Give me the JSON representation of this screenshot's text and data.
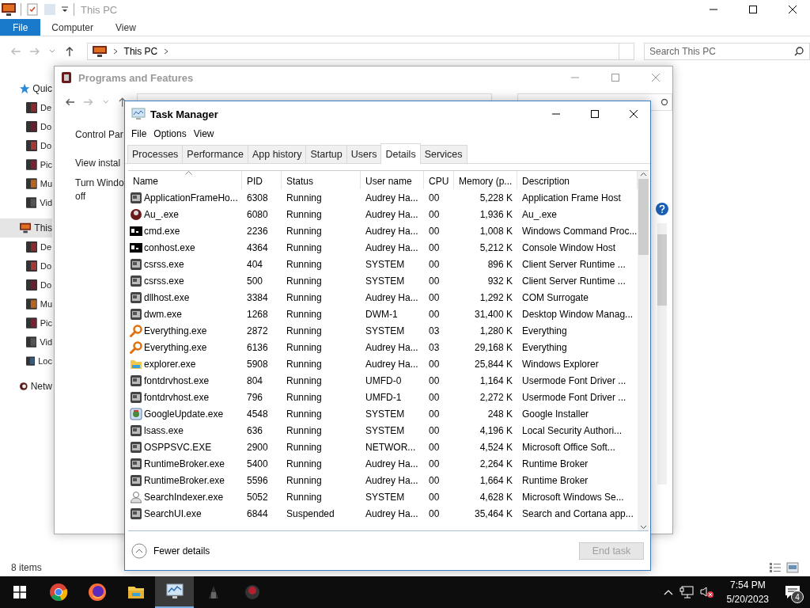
{
  "explorer": {
    "title": "This PC",
    "ribbon_tabs": [
      {
        "label": "File",
        "selected": true
      },
      {
        "label": "Computer",
        "selected": false
      },
      {
        "label": "View",
        "selected": false
      }
    ],
    "address": [
      "This PC"
    ],
    "search": {
      "placeholder": "Search This PC"
    },
    "nav": [
      {
        "label": "Quic",
        "kind": "star",
        "selected": false,
        "children": [
          {
            "label": "De",
            "kind": "desktop",
            "selected": false
          },
          {
            "label": "Do",
            "kind": "downloads",
            "selected": false
          },
          {
            "label": "Do",
            "kind": "documents",
            "selected": false
          },
          {
            "label": "Pic",
            "kind": "pictures",
            "selected": false
          },
          {
            "label": "Mu",
            "kind": "music",
            "selected": false
          },
          {
            "label": "Vid",
            "kind": "videos",
            "selected": false
          }
        ]
      },
      {
        "label": "This",
        "kind": "pc",
        "selected": true,
        "children": [
          {
            "label": "De",
            "kind": "desktop",
            "selected": false
          },
          {
            "label": "Do",
            "kind": "documents",
            "selected": false
          },
          {
            "label": "Do",
            "kind": "downloads",
            "selected": false
          },
          {
            "label": "Mu",
            "kind": "music",
            "selected": false
          },
          {
            "label": "Pic",
            "kind": "pictures",
            "selected": false
          },
          {
            "label": "Vid",
            "kind": "videos",
            "selected": false
          },
          {
            "label": "Loc",
            "kind": "drive",
            "selected": false
          }
        ]
      },
      {
        "label": "Netw",
        "kind": "network",
        "selected": false
      }
    ],
    "status": "8 items"
  },
  "programs_window": {
    "title": "Programs and Features",
    "links": [
      "Control Par",
      "View instal",
      "Turn Windo off"
    ]
  },
  "task_manager": {
    "title": "Task Manager",
    "menu": [
      "File",
      "Options",
      "View"
    ],
    "tabs": [
      {
        "label": "Processes",
        "selected": false
      },
      {
        "label": "Performance",
        "selected": false
      },
      {
        "label": "App history",
        "selected": false
      },
      {
        "label": "Startup",
        "selected": false
      },
      {
        "label": "Users",
        "selected": false
      },
      {
        "label": "Details",
        "selected": true
      },
      {
        "label": "Services",
        "selected": false
      }
    ],
    "columns": [
      {
        "label": "Name",
        "sorted": true
      },
      {
        "label": "PID",
        "sorted": false
      },
      {
        "label": "Status",
        "sorted": false
      },
      {
        "label": "User name",
        "sorted": false
      },
      {
        "label": "CPU",
        "sorted": false
      },
      {
        "label": "Memory (p...",
        "sorted": false
      },
      {
        "label": "Description",
        "sorted": false
      }
    ],
    "rows": [
      {
        "kind": "app",
        "name": "ApplicationFrameHo...",
        "pid": "6308",
        "status": "Running",
        "user": "Audrey Ha...",
        "cpu": "00",
        "memory": "5,228 K",
        "description": "Application Frame Host"
      },
      {
        "kind": "round",
        "name": "Au_.exe",
        "pid": "6080",
        "status": "Running",
        "user": "Audrey Ha...",
        "cpu": "00",
        "memory": "1,936 K",
        "description": "Au_.exe"
      },
      {
        "kind": "console",
        "name": "cmd.exe",
        "pid": "2236",
        "status": "Running",
        "user": "Audrey Ha...",
        "cpu": "00",
        "memory": "1,008 K",
        "description": "Windows Command Proc..."
      },
      {
        "kind": "console",
        "name": "conhost.exe",
        "pid": "4364",
        "status": "Running",
        "user": "Audrey Ha...",
        "cpu": "00",
        "memory": "5,212 K",
        "description": "Console Window Host"
      },
      {
        "kind": "app",
        "name": "csrss.exe",
        "pid": "404",
        "status": "Running",
        "user": "SYSTEM",
        "cpu": "00",
        "memory": "896 K",
        "description": "Client Server Runtime ..."
      },
      {
        "kind": "app",
        "name": "csrss.exe",
        "pid": "500",
        "status": "Running",
        "user": "SYSTEM",
        "cpu": "00",
        "memory": "932 K",
        "description": "Client Server Runtime ..."
      },
      {
        "kind": "app",
        "name": "dllhost.exe",
        "pid": "3384",
        "status": "Running",
        "user": "Audrey Ha...",
        "cpu": "00",
        "memory": "1,292 K",
        "description": "COM Surrogate"
      },
      {
        "kind": "app",
        "name": "dwm.exe",
        "pid": "1268",
        "status": "Running",
        "user": "DWM-1",
        "cpu": "00",
        "memory": "31,400 K",
        "description": "Desktop Window Manag..."
      },
      {
        "kind": "magnifier",
        "name": "Everything.exe",
        "pid": "2872",
        "status": "Running",
        "user": "SYSTEM",
        "cpu": "03",
        "memory": "1,280 K",
        "description": "Everything"
      },
      {
        "kind": "magnifier",
        "name": "Everything.exe",
        "pid": "6136",
        "status": "Running",
        "user": "Audrey Ha...",
        "cpu": "03",
        "memory": "29,168 K",
        "description": "Everything"
      },
      {
        "kind": "folder",
        "name": "explorer.exe",
        "pid": "5908",
        "status": "Running",
        "user": "Audrey Ha...",
        "cpu": "00",
        "memory": "25,844 K",
        "description": "Windows Explorer"
      },
      {
        "kind": "app",
        "name": "fontdrvhost.exe",
        "pid": "804",
        "status": "Running",
        "user": "UMFD-0",
        "cpu": "00",
        "memory": "1,164 K",
        "description": "Usermode Font Driver ..."
      },
      {
        "kind": "app",
        "name": "fontdrvhost.exe",
        "pid": "796",
        "status": "Running",
        "user": "UMFD-1",
        "cpu": "00",
        "memory": "2,272 K",
        "description": "Usermode Font Driver ..."
      },
      {
        "kind": "installer",
        "name": "GoogleUpdate.exe",
        "pid": "4548",
        "status": "Running",
        "user": "SYSTEM",
        "cpu": "00",
        "memory": "248 K",
        "description": "Google Installer"
      },
      {
        "kind": "app",
        "name": "lsass.exe",
        "pid": "636",
        "status": "Running",
        "user": "SYSTEM",
        "cpu": "00",
        "memory": "4,196 K",
        "description": "Local Security Authori..."
      },
      {
        "kind": "app",
        "name": "OSPPSVC.EXE",
        "pid": "2900",
        "status": "Running",
        "user": "NETWOR...",
        "cpu": "00",
        "memory": "4,524 K",
        "description": "Microsoft Office Soft..."
      },
      {
        "kind": "app",
        "name": "RuntimeBroker.exe",
        "pid": "5400",
        "status": "Running",
        "user": "Audrey Ha...",
        "cpu": "00",
        "memory": "2,264 K",
        "description": "Runtime Broker"
      },
      {
        "kind": "app",
        "name": "RuntimeBroker.exe",
        "pid": "5596",
        "status": "Running",
        "user": "Audrey Ha...",
        "cpu": "00",
        "memory": "1,664 K",
        "description": "Runtime Broker"
      },
      {
        "kind": "user",
        "name": "SearchIndexer.exe",
        "pid": "5052",
        "status": "Running",
        "user": "SYSTEM",
        "cpu": "00",
        "memory": "4,628 K",
        "description": "Microsoft Windows Se..."
      },
      {
        "kind": "app",
        "name": "SearchUI.exe",
        "pid": "6844",
        "status": "Suspended",
        "user": "Audrey Ha...",
        "cpu": "00",
        "memory": "35,464 K",
        "description": "Search and Cortana app..."
      }
    ],
    "fewer_details": "Fewer details",
    "end_task": {
      "label": "End task",
      "disabled": true
    }
  },
  "taskbar": {
    "apps": [
      {
        "kind": "chrome",
        "active": false
      },
      {
        "kind": "firefox",
        "active": false
      },
      {
        "kind": "folder",
        "active": false
      },
      {
        "kind": "taskmgr",
        "active": true
      },
      {
        "kind": "dark",
        "active": false
      },
      {
        "kind": "red",
        "active": false
      }
    ],
    "time": "7:54 PM",
    "date": "5/20/2023",
    "notifications": "4"
  }
}
